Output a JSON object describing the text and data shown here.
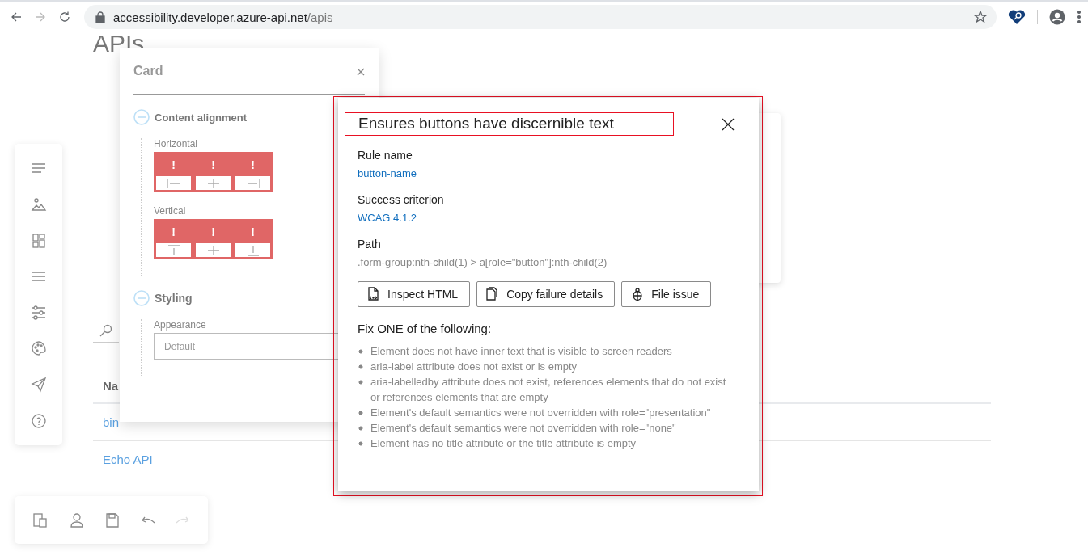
{
  "browser": {
    "nav": [
      {
        "kind": "back",
        "disabled": false
      },
      {
        "kind": "forward",
        "disabled": true
      },
      {
        "kind": "reload",
        "disabled": false
      }
    ],
    "url": {
      "host": "accessibility.developer.azure-api.net",
      "path": "/apis"
    }
  },
  "page": {
    "title": "APIs",
    "table": {
      "column_1": "Na",
      "rows": [
        {
          "name": "bin"
        },
        {
          "name": "Echo API"
        }
      ]
    }
  },
  "side_rail": [
    {
      "kind": "text"
    },
    {
      "kind": "image"
    },
    {
      "kind": "layout"
    },
    {
      "kind": "lines"
    },
    {
      "kind": "sliders"
    },
    {
      "kind": "palette"
    },
    {
      "kind": "send"
    },
    {
      "kind": "help"
    }
  ],
  "bottom_toolbar": [
    {
      "kind": "devices",
      "disabled": false
    },
    {
      "kind": "person",
      "disabled": false
    },
    {
      "kind": "save",
      "disabled": false
    },
    {
      "kind": "undo",
      "disabled": false
    },
    {
      "kind": "redo",
      "disabled": true
    }
  ],
  "card_panel": {
    "title": "Card",
    "sections": [
      {
        "title": "Content alignment",
        "expanded": true,
        "groups": [
          {
            "label": "Horizontal",
            "buttons": [
              {
                "kind": "left",
                "flag": "!"
              },
              {
                "kind": "center",
                "flag": "!"
              },
              {
                "kind": "right",
                "flag": "!"
              }
            ]
          },
          {
            "label": "Vertical",
            "buttons": [
              {
                "kind": "top",
                "flag": "!"
              },
              {
                "kind": "middle",
                "flag": "!"
              },
              {
                "kind": "bottom",
                "flag": "!"
              }
            ]
          }
        ]
      },
      {
        "title": "Styling",
        "expanded": true,
        "fields": [
          {
            "label": "Appearance",
            "value": "Default"
          }
        ]
      }
    ]
  },
  "dialog": {
    "outlined": true,
    "title": "Ensures buttons have discernible text",
    "title_outlined": true,
    "details": [
      {
        "heading": "Rule name",
        "link": "button-name"
      },
      {
        "heading": "Success criterion",
        "link": "WCAG 4.1.2"
      },
      {
        "heading": "Path",
        "text": ".form-group:nth-child(1) > a[role=\"button\"]:nth-child(2)"
      }
    ],
    "buttons": [
      {
        "kind": "inspect",
        "label": "Inspect HTML"
      },
      {
        "kind": "copy",
        "label": "Copy failure details"
      },
      {
        "kind": "bug",
        "label": "File issue"
      }
    ],
    "fix_heading": "Fix ONE of the following:",
    "fix_items": [
      "Element does not have inner text that is visible to screen readers",
      "aria-label attribute does not exist or is empty",
      "aria-labelledby attribute does not exist, references elements that do not exist or references elements that are empty",
      "Element's default semantics were not overridden with role=\"presentation\"",
      "Element's default semantics were not overridden with role=\"none\"",
      "Element has no title attribute or the title attribute is empty"
    ]
  }
}
